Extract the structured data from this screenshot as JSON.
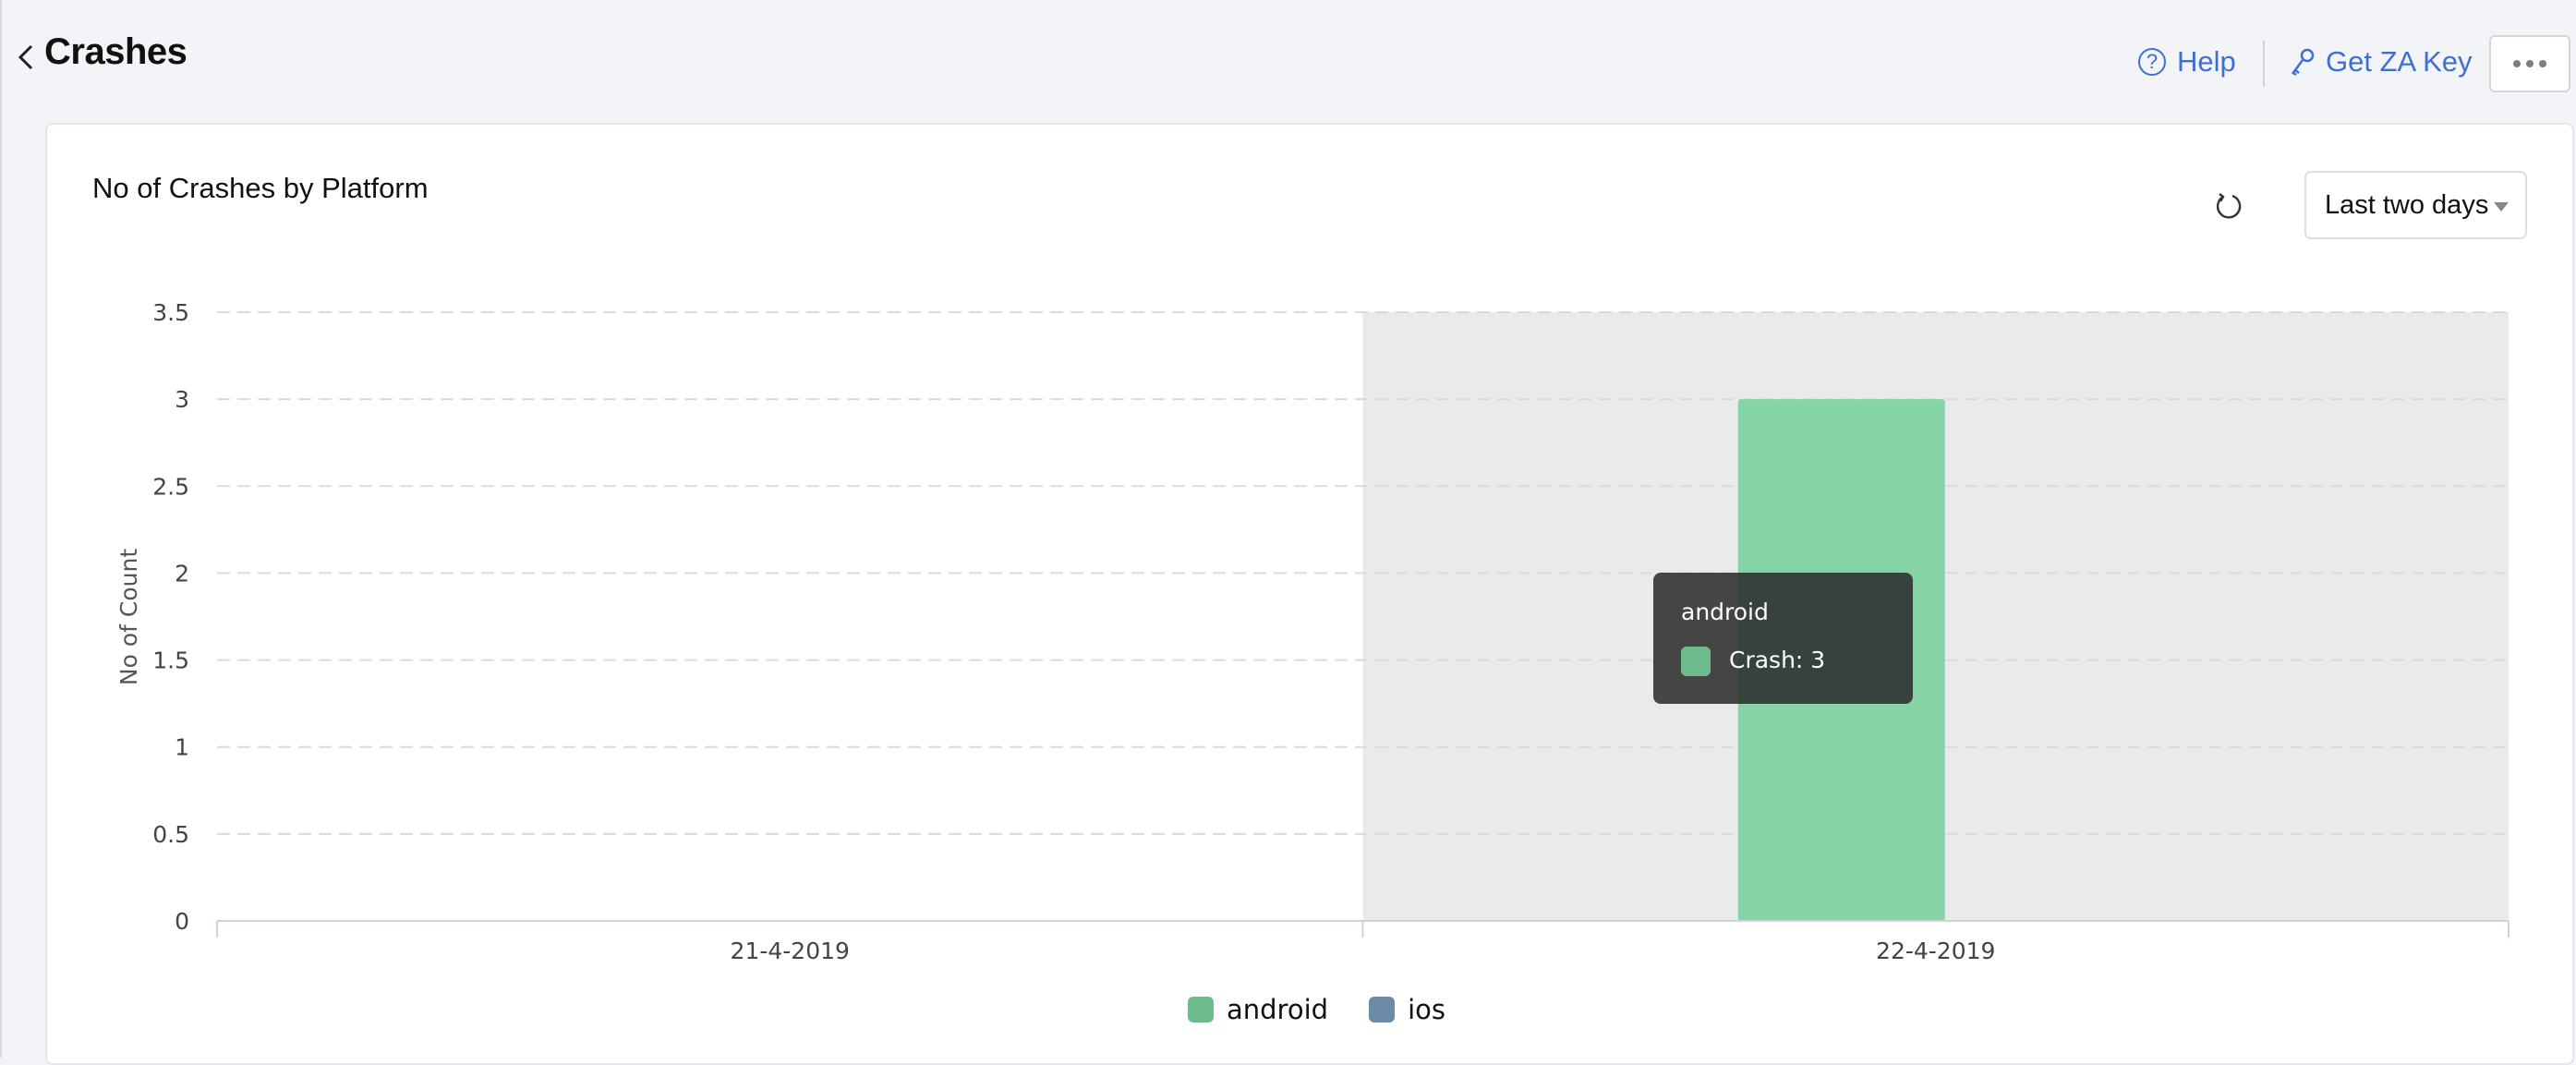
{
  "header": {
    "title": "Crashes",
    "help_label": "Help",
    "get_key_label": "Get ZA Key"
  },
  "card": {
    "title": "No of Crashes by Platform",
    "range_selected": "Last two days"
  },
  "tooltip": {
    "title": "android",
    "value_text": "Crash: 3",
    "swatch_color": "#6dbb8d"
  },
  "colors": {
    "link": "#3f6fd1",
    "highlight_band": "#e9eaea"
  },
  "chart_data": {
    "type": "bar",
    "title": "No of Crashes by Platform",
    "xlabel": "",
    "ylabel": "No of Count",
    "categories": [
      "21-4-2019",
      "22-4-2019"
    ],
    "series": [
      {
        "name": "android",
        "color": "#86d4a5",
        "legend_color": "#6dbb8d",
        "values": [
          0,
          3
        ]
      },
      {
        "name": "ios",
        "color": "#6b8aa8",
        "legend_color": "#6b8aa8",
        "values": [
          0,
          0
        ]
      }
    ],
    "ylim": [
      0,
      3.5
    ],
    "yticks": [
      0,
      0.5,
      1,
      1.5,
      2,
      2.5,
      3,
      3.5
    ],
    "ytick_labels": [
      "0",
      "0.5",
      "1",
      "1.5",
      "2",
      "2.5",
      "3",
      "3.5"
    ],
    "grid": true,
    "highlighted_category": "22-4-2019",
    "legend_position": "bottom-center"
  }
}
